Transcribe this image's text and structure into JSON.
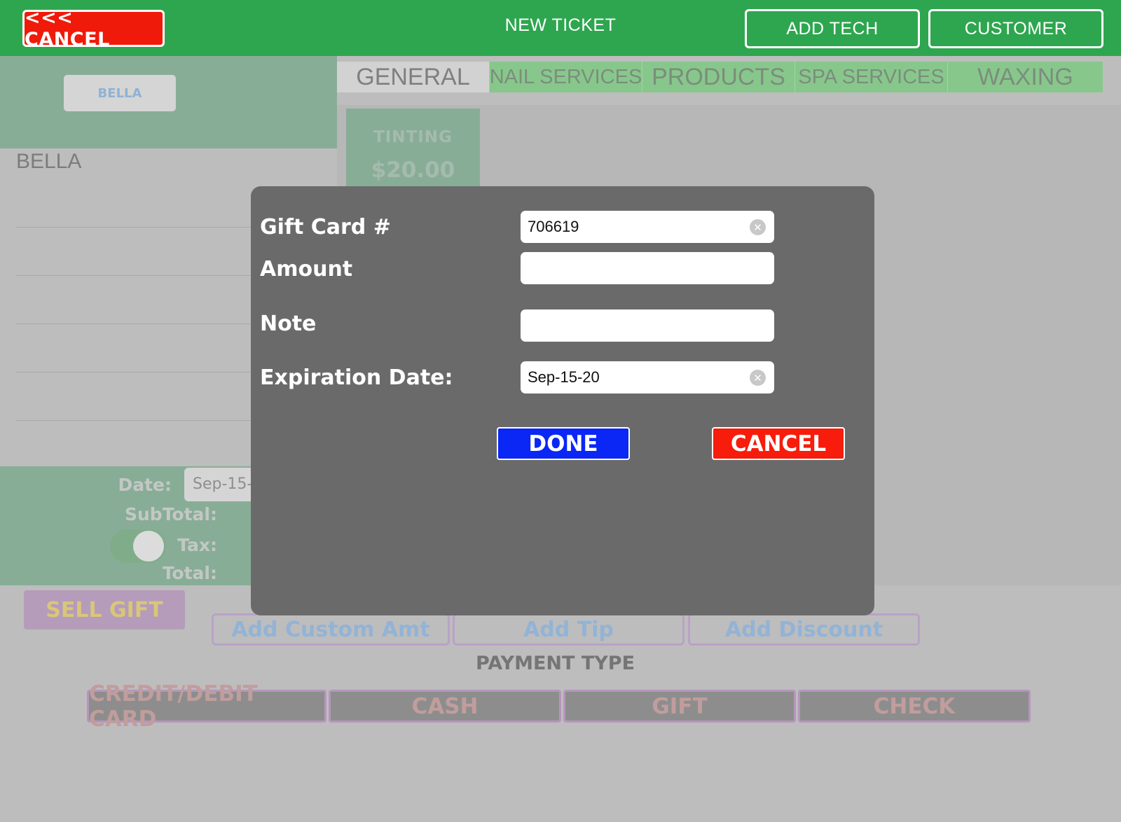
{
  "topbar": {
    "cancel_label": "<<< CANCEL",
    "title": "NEW TICKET",
    "add_tech_label": "ADD TECH",
    "customer_label": "CUSTOMER"
  },
  "tech": {
    "chip_label": "BELLA",
    "name": "BELLA"
  },
  "tabs": [
    {
      "label": "GENERAL"
    },
    {
      "label": "NAIL SERVICES"
    },
    {
      "label": "PRODUCTS"
    },
    {
      "label": "SPA SERVICES"
    },
    {
      "label": "WAXING"
    }
  ],
  "service": {
    "name": "TINTING",
    "price": "$20.00"
  },
  "summary": {
    "date_label": "Date:",
    "date_value": "Sep-15-",
    "subtotal_label": "SubTotal:",
    "tax_label": "Tax:",
    "total_label": "Total:"
  },
  "actions": {
    "sell_gift": "SELL GIFT",
    "add_custom_amt": "Add Custom Amt",
    "add_tip": "Add Tip",
    "add_discount": "Add Discount"
  },
  "payment": {
    "label": "PAYMENT TYPE",
    "types": [
      {
        "label": "CREDIT/DEBIT CARD"
      },
      {
        "label": "CASH"
      },
      {
        "label": "GIFT"
      },
      {
        "label": "CHECK"
      }
    ]
  },
  "modal": {
    "gift_card_label": "Gift Card #",
    "gift_card_value": "706619",
    "amount_label": "Amount",
    "amount_value": "",
    "note_label": "Note",
    "note_value": "",
    "expiration_label": "Expiration Date:",
    "expiration_value": "Sep-15-20",
    "done_label": "DONE",
    "cancel_label": "CANCEL"
  },
  "colors": {
    "topbar": "#2ea64f",
    "done": "#0a27f5",
    "cancel": "#f71c0b"
  }
}
